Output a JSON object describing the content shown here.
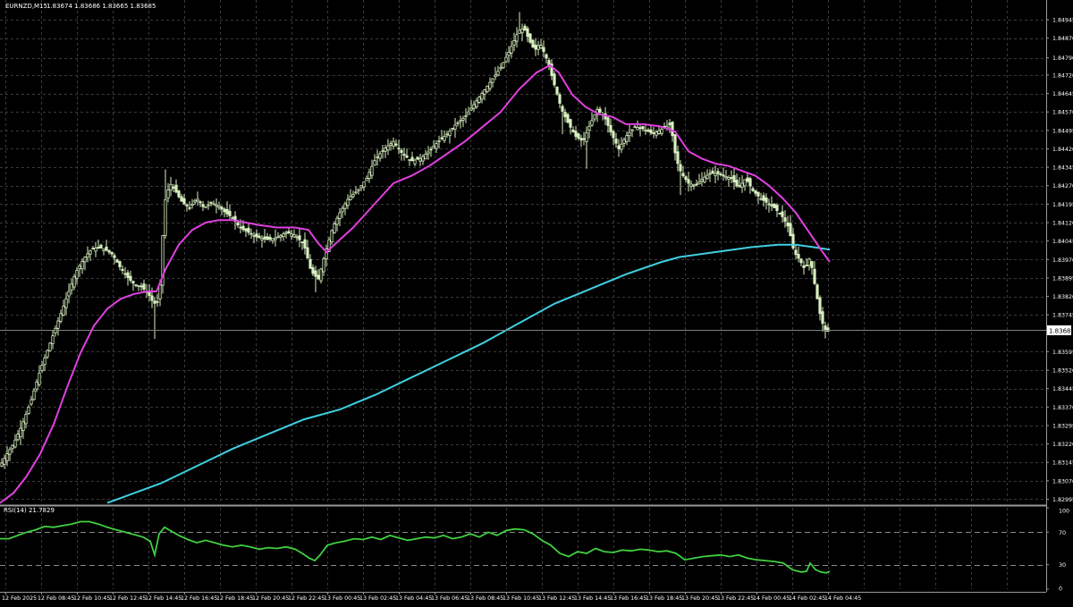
{
  "header": {
    "symbol_label": "EURNZD,M15",
    "ohlc_label": "1.83674 1.83686 1.83665 1.83685"
  },
  "indicator": {
    "label": "RSI(14) 21.7829"
  },
  "colors": {
    "background": "#000000",
    "grid": "#3a3a3a",
    "axis_text": "#ffffff",
    "candle": "#d8f0c0",
    "ma_fast": "#e040e0",
    "ma_slow": "#40d0e0",
    "rsi_line": "#40d040",
    "current_price_box": "#ffffff"
  },
  "chart_data": [
    {
      "type": "candlestick",
      "symbol": "EURNZD",
      "timeframe": "M15",
      "current_price": 1.83685,
      "y_ticks": [
        1.84945,
        1.8487,
        1.8479,
        1.8472,
        1.84645,
        1.8457,
        1.84495,
        1.8442,
        1.84345,
        1.8427,
        1.84195,
        1.8412,
        1.84045,
        1.8397,
        1.83895,
        1.8382,
        1.83745,
        1.83595,
        1.8352,
        1.83445,
        1.8337,
        1.83295,
        1.8322,
        1.83145,
        1.8307,
        1.82995
      ],
      "ylim": [
        1.82975,
        1.85025
      ],
      "x_ticks": [
        "12 Feb 2025",
        "12 Feb 08:45",
        "12 Feb 10:45",
        "12 Feb 12:45",
        "12 Feb 14:45",
        "12 Feb 16:45",
        "12 Feb 18:45",
        "12 Feb 20:45",
        "12 Feb 22:45",
        "13 Feb 00:45",
        "13 Feb 02:45",
        "13 Feb 04:45",
        "13 Feb 06:45",
        "13 Feb 08:45",
        "13 Feb 10:45",
        "13 Feb 12:45",
        "13 Feb 14:45",
        "13 Feb 16:45",
        "13 Feb 18:45",
        "13 Feb 20:45",
        "13 Feb 22:45",
        "14 Feb 00:45",
        "14 Feb 02:45",
        "14 Feb 04:45"
      ],
      "price_path": [
        [
          0,
          1.8313
        ],
        [
          8,
          1.8318
        ],
        [
          15,
          1.8322
        ],
        [
          25,
          1.833
        ],
        [
          35,
          1.834
        ],
        [
          45,
          1.8352
        ],
        [
          55,
          1.8362
        ],
        [
          65,
          1.8372
        ],
        [
          75,
          1.8382
        ],
        [
          85,
          1.8392
        ],
        [
          95,
          1.8398
        ],
        [
          102,
          1.8401
        ],
        [
          110,
          1.8402
        ],
        [
          118,
          1.8401
        ],
        [
          126,
          1.8399
        ],
        [
          134,
          1.8394
        ],
        [
          142,
          1.839
        ],
        [
          150,
          1.8387
        ],
        [
          158,
          1.8386
        ],
        [
          166,
          1.8383
        ],
        [
          172,
          1.8379
        ],
        [
          178,
          1.838
        ],
        [
          184,
          1.842
        ],
        [
          190,
          1.8428
        ],
        [
          196,
          1.8425
        ],
        [
          204,
          1.842
        ],
        [
          212,
          1.8418
        ],
        [
          220,
          1.8422
        ],
        [
          228,
          1.8418
        ],
        [
          236,
          1.842
        ],
        [
          244,
          1.8419
        ],
        [
          252,
          1.8416
        ],
        [
          260,
          1.8414
        ],
        [
          268,
          1.841
        ],
        [
          278,
          1.8408
        ],
        [
          288,
          1.8406
        ],
        [
          300,
          1.8405
        ],
        [
          310,
          1.8406
        ],
        [
          320,
          1.8408
        ],
        [
          330,
          1.8407
        ],
        [
          340,
          1.8403
        ],
        [
          348,
          1.8392
        ],
        [
          356,
          1.8389
        ],
        [
          364,
          1.84
        ],
        [
          372,
          1.841
        ],
        [
          380,
          1.8416
        ],
        [
          390,
          1.8422
        ],
        [
          400,
          1.8425
        ],
        [
          410,
          1.843
        ],
        [
          420,
          1.8438
        ],
        [
          430,
          1.8442
        ],
        [
          440,
          1.8445
        ],
        [
          450,
          1.844
        ],
        [
          460,
          1.8437
        ],
        [
          470,
          1.8438
        ],
        [
          480,
          1.8441
        ],
        [
          490,
          1.8445
        ],
        [
          500,
          1.8448
        ],
        [
          510,
          1.8452
        ],
        [
          520,
          1.8455
        ],
        [
          530,
          1.846
        ],
        [
          540,
          1.8465
        ],
        [
          550,
          1.847
        ],
        [
          560,
          1.8475
        ],
        [
          570,
          1.8482
        ],
        [
          580,
          1.849
        ],
        [
          586,
          1.8491
        ],
        [
          592,
          1.8486
        ],
        [
          598,
          1.8482
        ],
        [
          604,
          1.8485
        ],
        [
          612,
          1.8478
        ],
        [
          620,
          1.8468
        ],
        [
          628,
          1.8458
        ],
        [
          636,
          1.8452
        ],
        [
          644,
          1.8447
        ],
        [
          652,
          1.8445
        ],
        [
          660,
          1.8452
        ],
        [
          668,
          1.8458
        ],
        [
          676,
          1.8455
        ],
        [
          684,
          1.8448
        ],
        [
          692,
          1.8442
        ],
        [
          700,
          1.8447
        ],
        [
          710,
          1.8451
        ],
        [
          720,
          1.845
        ],
        [
          730,
          1.8448
        ],
        [
          740,
          1.845
        ],
        [
          750,
          1.8452
        ],
        [
          756,
          1.8438
        ],
        [
          762,
          1.8432
        ],
        [
          770,
          1.8428
        ],
        [
          778,
          1.8427
        ],
        [
          786,
          1.843
        ],
        [
          794,
          1.8432
        ],
        [
          802,
          1.8432
        ],
        [
          810,
          1.8431
        ],
        [
          818,
          1.843
        ],
        [
          826,
          1.8426
        ],
        [
          834,
          1.843
        ],
        [
          842,
          1.8425
        ],
        [
          850,
          1.8422
        ],
        [
          858,
          1.842
        ],
        [
          866,
          1.8418
        ],
        [
          874,
          1.8415
        ],
        [
          882,
          1.841
        ],
        [
          888,
          1.84
        ],
        [
          894,
          1.8397
        ],
        [
          900,
          1.8393
        ],
        [
          906,
          1.8398
        ],
        [
          912,
          1.8385
        ],
        [
          918,
          1.8373
        ],
        [
          924,
          1.8367
        ],
        [
          928,
          1.83685
        ]
      ],
      "ma_fast": [
        [
          0,
          1.8298
        ],
        [
          15,
          1.8302
        ],
        [
          30,
          1.8309
        ],
        [
          45,
          1.8318
        ],
        [
          60,
          1.833
        ],
        [
          75,
          1.8345
        ],
        [
          90,
          1.8359
        ],
        [
          105,
          1.837
        ],
        [
          120,
          1.8377
        ],
        [
          135,
          1.8381
        ],
        [
          150,
          1.8383
        ],
        [
          165,
          1.8384
        ],
        [
          175,
          1.8384
        ],
        [
          185,
          1.8393
        ],
        [
          200,
          1.8403
        ],
        [
          215,
          1.8409
        ],
        [
          230,
          1.8412
        ],
        [
          245,
          1.8413
        ],
        [
          260,
          1.8413
        ],
        [
          275,
          1.8412
        ],
        [
          290,
          1.8411
        ],
        [
          310,
          1.841
        ],
        [
          330,
          1.841
        ],
        [
          345,
          1.8409
        ],
        [
          355,
          1.8404
        ],
        [
          365,
          1.84
        ],
        [
          380,
          1.8405
        ],
        [
          395,
          1.841
        ],
        [
          410,
          1.8416
        ],
        [
          425,
          1.8422
        ],
        [
          440,
          1.8428
        ],
        [
          460,
          1.8431
        ],
        [
          480,
          1.8435
        ],
        [
          500,
          1.844
        ],
        [
          520,
          1.8445
        ],
        [
          540,
          1.8451
        ],
        [
          560,
          1.8457
        ],
        [
          580,
          1.8466
        ],
        [
          600,
          1.8473
        ],
        [
          615,
          1.8476
        ],
        [
          625,
          1.8473
        ],
        [
          640,
          1.8464
        ],
        [
          655,
          1.8459
        ],
        [
          670,
          1.8456
        ],
        [
          685,
          1.8455
        ],
        [
          700,
          1.8452
        ],
        [
          720,
          1.8452
        ],
        [
          740,
          1.8451
        ],
        [
          755,
          1.8449
        ],
        [
          770,
          1.8441
        ],
        [
          785,
          1.8438
        ],
        [
          800,
          1.8436
        ],
        [
          815,
          1.8435
        ],
        [
          830,
          1.8433
        ],
        [
          845,
          1.8431
        ],
        [
          860,
          1.8427
        ],
        [
          875,
          1.8422
        ],
        [
          890,
          1.8416
        ],
        [
          905,
          1.8408
        ],
        [
          920,
          1.84
        ],
        [
          928,
          1.8396
        ]
      ],
      "ma_slow": [
        [
          120,
          1.8298
        ],
        [
          150,
          1.8302
        ],
        [
          180,
          1.8306
        ],
        [
          220,
          1.8313
        ],
        [
          260,
          1.832
        ],
        [
          300,
          1.8326
        ],
        [
          340,
          1.8332
        ],
        [
          380,
          1.8336
        ],
        [
          420,
          1.8342
        ],
        [
          460,
          1.8349
        ],
        [
          500,
          1.8356
        ],
        [
          540,
          1.8363
        ],
        [
          580,
          1.8371
        ],
        [
          620,
          1.8379
        ],
        [
          660,
          1.8385
        ],
        [
          700,
          1.8391
        ],
        [
          740,
          1.8396
        ],
        [
          760,
          1.8398
        ],
        [
          800,
          1.84
        ],
        [
          840,
          1.8402
        ],
        [
          870,
          1.8403
        ],
        [
          890,
          1.8403
        ],
        [
          910,
          1.8402
        ],
        [
          928,
          1.8401
        ]
      ]
    },
    {
      "type": "line",
      "name": "RSI(14)",
      "current_value": 21.7829,
      "ylim": [
        0,
        100
      ],
      "y_ticks": [
        100,
        70,
        30,
        0
      ],
      "levels": [
        70,
        30
      ],
      "values": [
        [
          0,
          62
        ],
        [
          10,
          62
        ],
        [
          20,
          66
        ],
        [
          30,
          70
        ],
        [
          40,
          73
        ],
        [
          50,
          77
        ],
        [
          60,
          76
        ],
        [
          70,
          78
        ],
        [
          80,
          80
        ],
        [
          90,
          83
        ],
        [
          100,
          83
        ],
        [
          110,
          80
        ],
        [
          120,
          76
        ],
        [
          130,
          73
        ],
        [
          140,
          70
        ],
        [
          150,
          67
        ],
        [
          160,
          64
        ],
        [
          168,
          59
        ],
        [
          173,
          42
        ],
        [
          178,
          68
        ],
        [
          184,
          76
        ],
        [
          192,
          71
        ],
        [
          200,
          66
        ],
        [
          210,
          61
        ],
        [
          220,
          57
        ],
        [
          230,
          60
        ],
        [
          240,
          57
        ],
        [
          250,
          54
        ],
        [
          260,
          52
        ],
        [
          270,
          54
        ],
        [
          280,
          52
        ],
        [
          290,
          49
        ],
        [
          300,
          51
        ],
        [
          310,
          50
        ],
        [
          320,
          52
        ],
        [
          330,
          49
        ],
        [
          338,
          44
        ],
        [
          346,
          38
        ],
        [
          352,
          35
        ],
        [
          358,
          42
        ],
        [
          366,
          54
        ],
        [
          376,
          57
        ],
        [
          386,
          59
        ],
        [
          396,
          62
        ],
        [
          406,
          61
        ],
        [
          416,
          64
        ],
        [
          426,
          61
        ],
        [
          436,
          66
        ],
        [
          446,
          63
        ],
        [
          456,
          60
        ],
        [
          466,
          62
        ],
        [
          476,
          64
        ],
        [
          486,
          63
        ],
        [
          496,
          66
        ],
        [
          506,
          62
        ],
        [
          516,
          64
        ],
        [
          526,
          68
        ],
        [
          536,
          64
        ],
        [
          546,
          70
        ],
        [
          556,
          66
        ],
        [
          566,
          72
        ],
        [
          576,
          74
        ],
        [
          586,
          73
        ],
        [
          596,
          68
        ],
        [
          606,
          60
        ],
        [
          616,
          54
        ],
        [
          626,
          44
        ],
        [
          636,
          40
        ],
        [
          646,
          46
        ],
        [
          656,
          44
        ],
        [
          666,
          50
        ],
        [
          676,
          46
        ],
        [
          686,
          45
        ],
        [
          696,
          48
        ],
        [
          706,
          47
        ],
        [
          716,
          49
        ],
        [
          726,
          48
        ],
        [
          736,
          46
        ],
        [
          746,
          47
        ],
        [
          756,
          44
        ],
        [
          766,
          36
        ],
        [
          776,
          38
        ],
        [
          786,
          40
        ],
        [
          796,
          41
        ],
        [
          806,
          42
        ],
        [
          816,
          40
        ],
        [
          826,
          42
        ],
        [
          836,
          38
        ],
        [
          846,
          36
        ],
        [
          856,
          35
        ],
        [
          866,
          34
        ],
        [
          876,
          32
        ],
        [
          886,
          24
        ],
        [
          896,
          21
        ],
        [
          902,
          22
        ],
        [
          906,
          32
        ],
        [
          912,
          24
        ],
        [
          918,
          21
        ],
        [
          924,
          20
        ],
        [
          928,
          21.8
        ]
      ]
    }
  ]
}
